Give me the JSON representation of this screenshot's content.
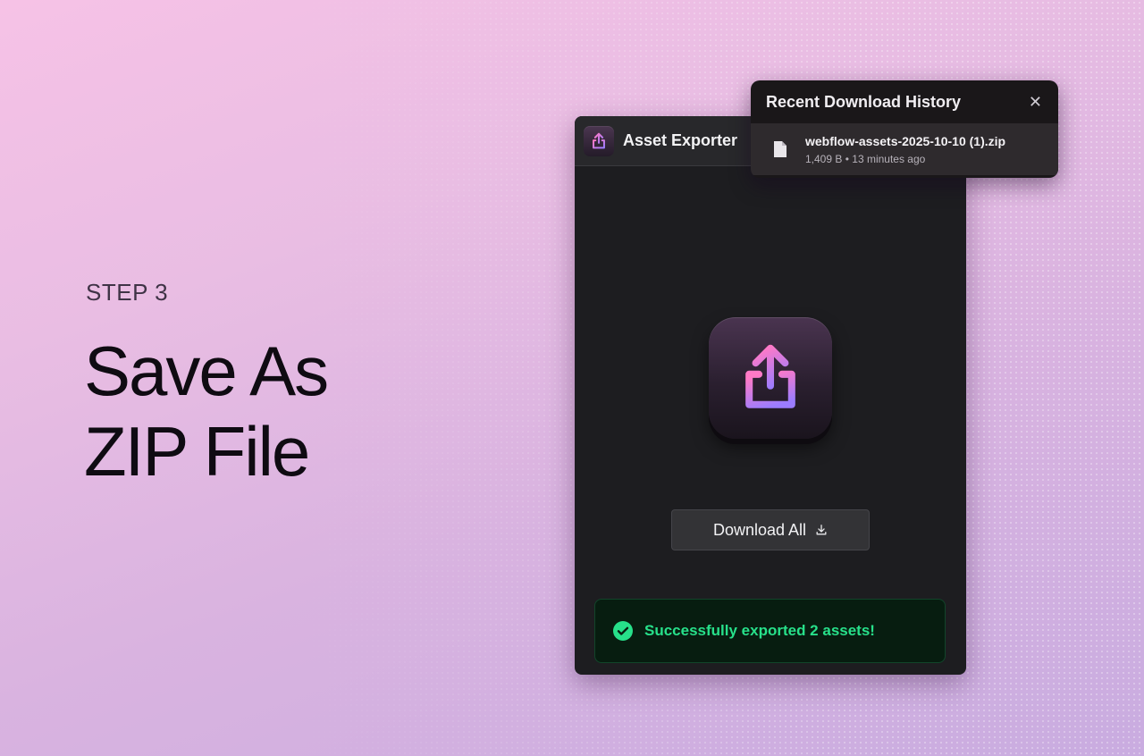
{
  "promo": {
    "step_label": "STEP 3",
    "headline_line1": "Save As",
    "headline_line2": "ZIP File"
  },
  "window": {
    "title": "Asset Exporter",
    "app_icon": "share-upload-icon",
    "hero_icon": "share-upload-icon"
  },
  "actions": {
    "download_all_label": "Download All",
    "download_icon": "download-icon"
  },
  "status": {
    "message": "Successfully exported 2 assets!",
    "icon": "check-circle-icon",
    "color": "#27e08a"
  },
  "history": {
    "title": "Recent Download History",
    "close_icon": "close-icon",
    "items": [
      {
        "file_name": "webflow-assets-2025-10-10 (1).zip",
        "size": "1,409 B",
        "separator": "•",
        "time": "13 minutes ago",
        "icon": "file-icon"
      }
    ]
  },
  "colors": {
    "accent_gradient_start": "#ff7ac6",
    "accent_gradient_end": "#9b7cff",
    "window_bg": "#1d1d20",
    "success_bg": "#071d10"
  }
}
